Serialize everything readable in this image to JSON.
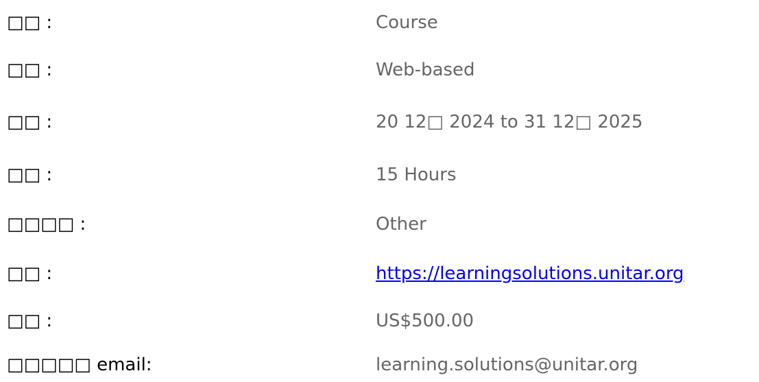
{
  "details": {
    "rows": [
      {
        "label": "□□  :",
        "value": "Course"
      },
      {
        "label": "□□  :",
        "value": "Web-based"
      },
      {
        "label": "□□  :",
        "value": "20 12□  2024 to 31 12□  2025"
      },
      {
        "label": "□□  :",
        "value": "15 Hours"
      },
      {
        "label": "□□□□        :",
        "value": "Other"
      },
      {
        "label": "□□  :",
        "value": "https://learningsolutions.unitar.org"
      },
      {
        "label": "□□  :",
        "value": "US$500.00"
      },
      {
        "label": "□□□□□          email:",
        "value": "learning.solutions@unitar.org"
      }
    ]
  }
}
